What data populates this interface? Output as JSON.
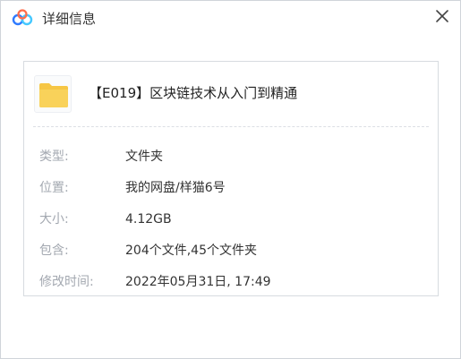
{
  "window": {
    "title": "详细信息",
    "logo_icon": "baidu-netdisk-cloud-icon",
    "close_icon": "close-icon",
    "accent_colors": [
      "#2f7bff",
      "#45c8ff",
      "#ff6c4a"
    ]
  },
  "file": {
    "icon": "folder-icon",
    "icon_color": "#f6c644",
    "name": "【E019】区块链技术从入门到精通"
  },
  "details": [
    {
      "label": "类型:",
      "value": "文件夹"
    },
    {
      "label": "位置:",
      "value": "我的网盘/样猫6号"
    },
    {
      "label": "大小:",
      "value": "4.12GB"
    },
    {
      "label": "包含:",
      "value": "204个文件,45个文件夹"
    },
    {
      "label": "修改时间:",
      "value": "2022年05月31日, 17:49"
    }
  ]
}
